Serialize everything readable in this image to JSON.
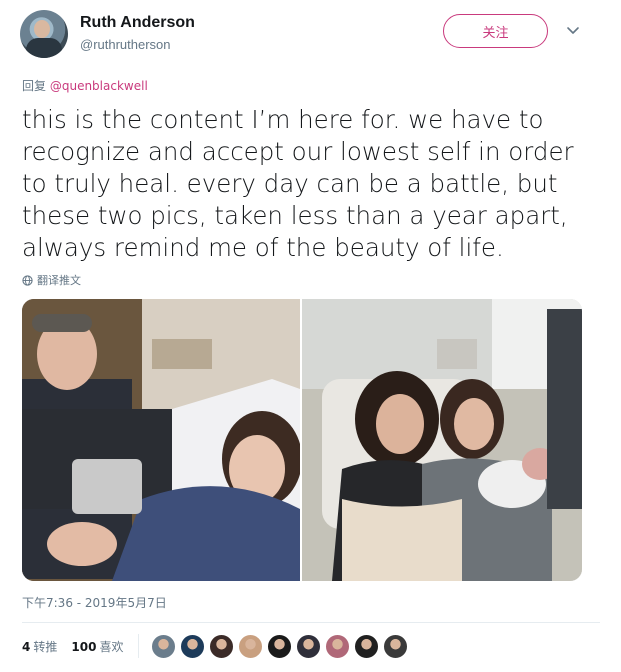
{
  "author": {
    "name": "Ruth Anderson",
    "handle": "@ruthrutherson"
  },
  "follow_button": {
    "label": "关注"
  },
  "reply": {
    "prefix": "回复",
    "to": "@quenblackwell"
  },
  "tweet": {
    "text": "this is the content I’m here for. we have to recognize and accept our lowest self in order to truly heal. every day can be a battle, but these two pics, taken less than a year apart, always remind me of the beauty of life."
  },
  "translate_label": "翻译推文",
  "timestamp": "下午7:36 - 2019年5月7日",
  "stats": {
    "retweets_count": "4",
    "retweets_label": "转推",
    "likes_count": "100",
    "likes_label": "喜欢"
  },
  "liker_avatars": [
    {
      "name": "liker-1",
      "color": "#6b7d8c"
    },
    {
      "name": "liker-2",
      "color": "#1d3b5a"
    },
    {
      "name": "liker-3",
      "color": "#3b2b28"
    },
    {
      "name": "liker-4",
      "color": "#c9a080"
    },
    {
      "name": "liker-5",
      "color": "#1a1a1a"
    },
    {
      "name": "liker-6",
      "color": "#2f2f3a"
    },
    {
      "name": "liker-7",
      "color": "#b06878"
    },
    {
      "name": "liker-8",
      "color": "#202020"
    },
    {
      "name": "liker-9",
      "color": "#3a3a3a"
    }
  ],
  "colors": {
    "accent": "#c93a7d",
    "secondary_text": "#657786",
    "primary_text": "#14171a"
  }
}
